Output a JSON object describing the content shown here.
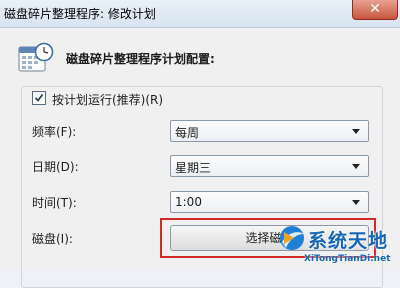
{
  "window": {
    "title": "磁盘碎片整理程序: 修改计划",
    "close_label": "✕"
  },
  "header": {
    "icon": "calendar-clock-icon",
    "label": "磁盘碎片整理程序计划配置:"
  },
  "schedule": {
    "run_on_schedule_label": "按计划运行(推荐)(R)",
    "run_on_schedule_checked": true,
    "frequency_label": "频率(F):",
    "frequency_value": "每周",
    "day_label": "日期(D):",
    "day_value": "星期三",
    "time_label": "时间(T):",
    "time_value": "1:00",
    "disks_label": "磁盘(I):",
    "select_disks_button": "选择磁盘"
  },
  "colors": {
    "highlight": "#cf2b2b",
    "watermark": "#1566b7"
  },
  "watermark": {
    "title": "系统天地",
    "url": "XiTongTianDi.net"
  }
}
